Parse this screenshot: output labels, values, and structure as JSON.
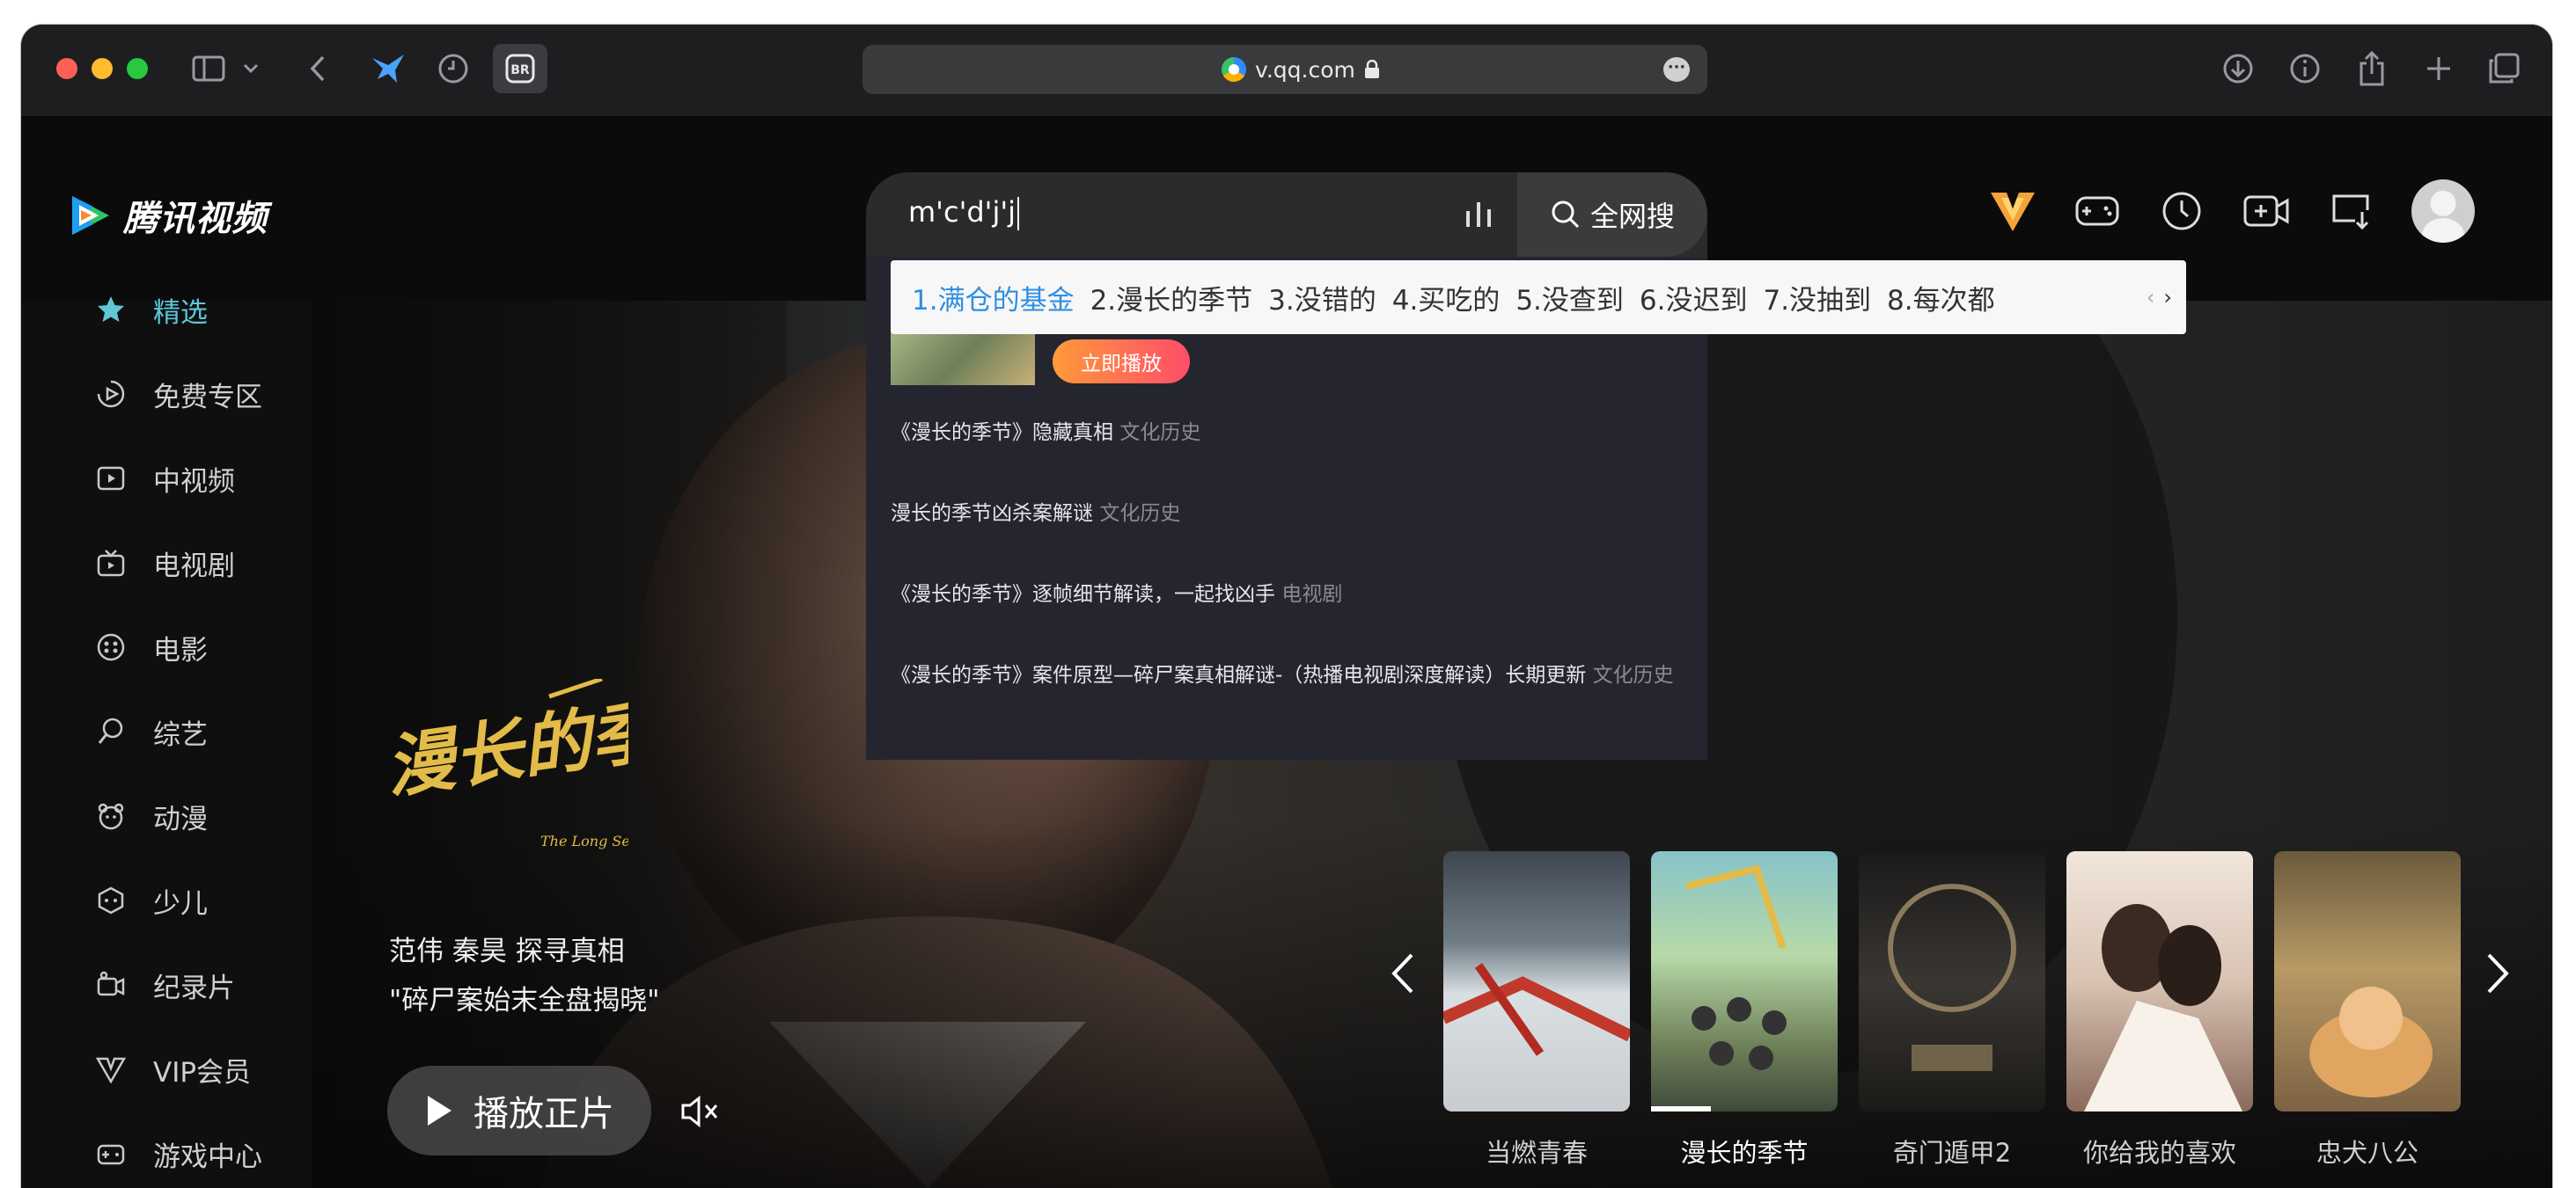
{
  "browser": {
    "url": "v.qq.com"
  },
  "header": {
    "logo_text": "腾讯视频",
    "search_value": "m'c'd'j'j",
    "search_button": "全网搜"
  },
  "hot_searches": {
    "items": [
      "1.满仓的基金",
      "2.漫长的季节",
      "3.没错的",
      "4.买吃的",
      "5.没查到",
      "6.没迟到",
      "7.没抽到",
      "8.每次都"
    ],
    "prev_arrow": "‹",
    "next_arrow": "›"
  },
  "suggestions": {
    "play_button": "立即播放",
    "items": [
      {
        "title": "《漫长的季节》隐藏真相",
        "category": "文化历史"
      },
      {
        "title": "漫长的季节凶杀案解谜",
        "category": "文化历史"
      },
      {
        "title": "《漫长的季节》逐帧细节解读，一起找凶手",
        "category": "电视剧"
      },
      {
        "title": "《漫长的季节》案件原型—碎尸案真相解谜-（热播电视剧深度解读）长期更新",
        "category": "文化历史"
      }
    ]
  },
  "sidebar": {
    "items": [
      {
        "label": "精选",
        "icon": "star-icon"
      },
      {
        "label": "免费专区",
        "icon": "free-play-icon"
      },
      {
        "label": "中视频",
        "icon": "video-icon"
      },
      {
        "label": "电视剧",
        "icon": "tv-icon"
      },
      {
        "label": "电影",
        "icon": "film-reel-icon"
      },
      {
        "label": "综艺",
        "icon": "microphone-icon"
      },
      {
        "label": "动漫",
        "icon": "bear-face-icon"
      },
      {
        "label": "少儿",
        "icon": "game-pad-icon"
      },
      {
        "label": "纪录片",
        "icon": "camera-icon"
      },
      {
        "label": "VIP会员",
        "icon": "vip-icon"
      },
      {
        "label": "游戏中心",
        "icon": "game-center-icon"
      }
    ],
    "active_index": 0
  },
  "hero": {
    "title_art": "漫长的季节",
    "title_art_en": "The Long Season",
    "line1": "范伟 秦昊 探寻真相",
    "line2": "\"碎尸案始末全盘揭晓\"",
    "play_button": "播放正片"
  },
  "carousel": {
    "items": [
      "当燃青春",
      "漫长的季节",
      "奇门遁甲2",
      "你给我的喜欢",
      "忠犬八公"
    ],
    "selected_index": 1
  },
  "colors": {
    "accent": "#5ec7d8",
    "hot_active": "#2f8fe0",
    "play_gradient_start": "#ff9a3a",
    "play_gradient_end": "#ff4d6a"
  }
}
